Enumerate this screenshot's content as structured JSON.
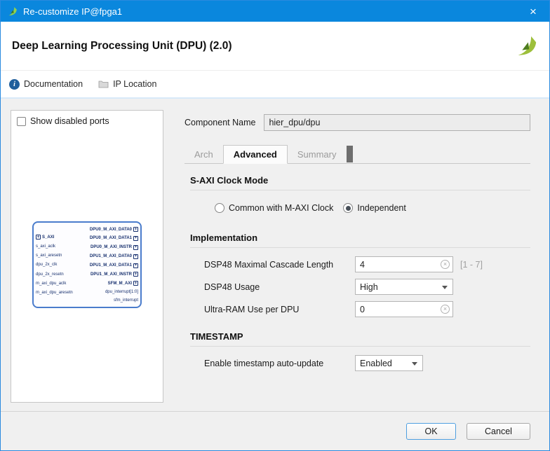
{
  "colors": {
    "titlebar": "#0a87dd",
    "accent_blue": "#2a8adf",
    "diagram_blue": "#4a7ccc",
    "diagram_text": "#17306e",
    "hint_gray": "#a0a0a0",
    "info_icon": "#205f9c",
    "logo_green": "#76a72f",
    "logo_dark_green": "#4e7d1e"
  },
  "icons": {
    "close": "×",
    "clear": "×",
    "plus": "+",
    "info": "i"
  },
  "window": {
    "title": "Re-customize IP@fpga1"
  },
  "header": {
    "title": "Deep Learning Processing Unit (DPU) (2.0)"
  },
  "toolbar": {
    "documentation_label": "Documentation",
    "ip_location_label": "IP Location"
  },
  "left_panel": {
    "show_disabled_ports_label": "Show disabled ports",
    "diagram": {
      "left_ports": [
        "S_AXI",
        "s_axi_aclk",
        "s_axi_aresetn",
        "dpu_2x_clk",
        "dpu_2x_resetn",
        "m_axi_dpu_aclk",
        "m_axi_dpu_aresetn"
      ],
      "right_ports": [
        "DPU0_M_AXI_DATA0",
        "DPU0_M_AXI_DATA1",
        "DPU0_M_AXI_INSTR",
        "DPU1_M_AXI_DATA0",
        "DPU1_M_AXI_DATA1",
        "DPU1_M_AXI_INSTR",
        "SFM_M_AXI",
        "dpu_interrupt[1:0]",
        "sfm_interrupt"
      ]
    }
  },
  "component": {
    "label": "Component Name",
    "value": "hier_dpu/dpu"
  },
  "tabs": {
    "arch": "Arch",
    "advanced": "Advanced",
    "summary": "Summary"
  },
  "clock_mode": {
    "title": "S-AXI Clock Mode",
    "option_common": "Common with M-AXI Clock",
    "option_independent": "Independent"
  },
  "implementation": {
    "title": "Implementation",
    "dsp48_cascade": {
      "label": "DSP48 Maximal Cascade Length",
      "value": "4",
      "hint": "[1 - 7]"
    },
    "dsp48_usage": {
      "label": "DSP48 Usage",
      "value": "High"
    },
    "ultra_ram": {
      "label": "Ultra-RAM Use per DPU",
      "value": "0"
    }
  },
  "timestamp": {
    "title": "TIMESTAMP",
    "auto_update": {
      "label": "Enable timestamp auto-update",
      "value": "Enabled"
    }
  },
  "footer": {
    "ok_label": "OK",
    "cancel_label": "Cancel"
  }
}
